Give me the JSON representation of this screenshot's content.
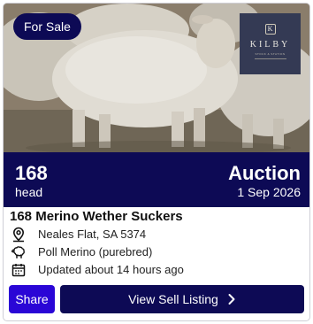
{
  "listing": {
    "badge": "For Sale",
    "logo": {
      "mark": "K",
      "name": "KILBY",
      "tagline": "STOCK & STATION"
    },
    "head_count": "168",
    "head_unit": "head",
    "sale_type": "Auction",
    "sale_date": "1 Sep 2026",
    "title": "168 Merino Wether Suckers",
    "location": "Neales Flat, SA 5374",
    "breed": "Poll Merino (purebred)",
    "updated": "Updated about 14 hours ago"
  },
  "actions": {
    "share_label": "Share",
    "view_label": "View Sell Listing"
  },
  "colors": {
    "navy": "#0d0a55",
    "share_blue": "#2a06d6",
    "logo_bg": "#343a54"
  }
}
